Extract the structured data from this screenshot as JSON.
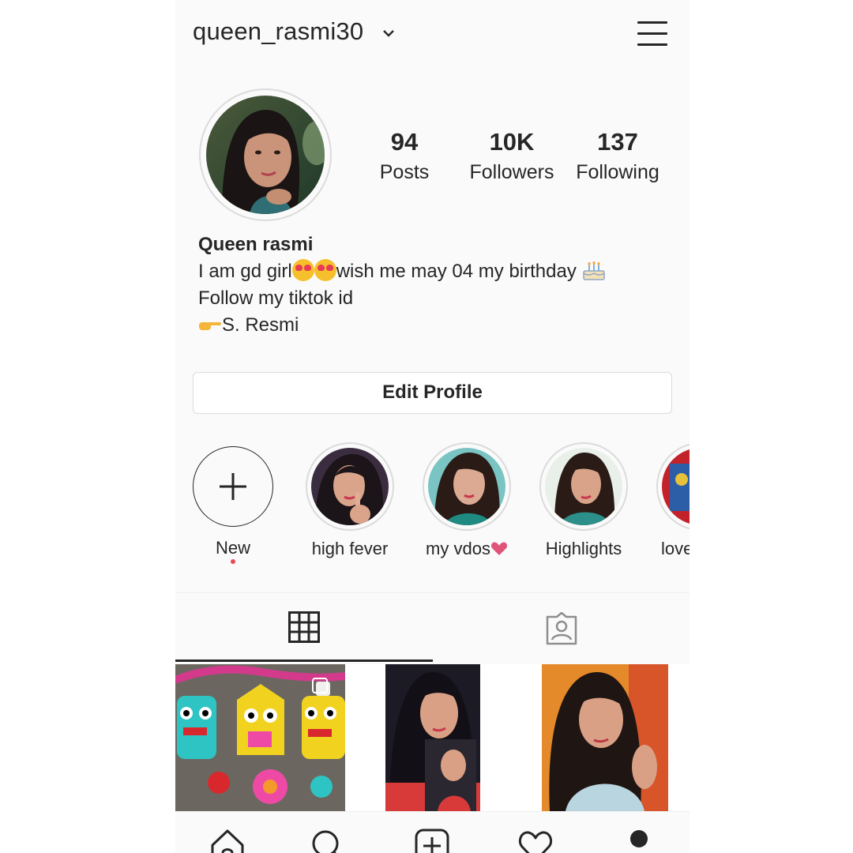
{
  "header": {
    "username": "queen_rasmi30",
    "switch_icon": "chevron-down-icon",
    "menu_icon": "hamburger-menu-icon"
  },
  "profile": {
    "avatar": "profile-photo",
    "stats": [
      {
        "value": "94",
        "label": "Posts"
      },
      {
        "value": "10K",
        "label": "Followers"
      },
      {
        "value": "137",
        "label": "Following"
      }
    ],
    "name": "Queen rasmi",
    "bio_line1_a": "I am gd girl",
    "bio_line1_b": "wish me may 04 my birthday ",
    "bio_line2": "Follow my tiktok id",
    "bio_line3": "S. Resmi"
  },
  "edit_profile_label": "Edit Profile",
  "highlights": [
    {
      "label": "New",
      "icon": "plus-icon"
    },
    {
      "label": "high fever"
    },
    {
      "label": "my vdos"
    },
    {
      "label": "Highlights"
    },
    {
      "label": "love"
    }
  ],
  "tabs": [
    {
      "icon": "grid-icon",
      "active": true
    },
    {
      "icon": "tagged-icon",
      "active": false
    }
  ],
  "bottom_nav": [
    "home-icon",
    "search-icon",
    "new-post-icon",
    "activity-heart-icon",
    "profile-icon"
  ],
  "colors": {
    "text": "#262626",
    "border": "#dbdbdb",
    "notification_dot": "#ed4956",
    "background": "#fafafa"
  }
}
